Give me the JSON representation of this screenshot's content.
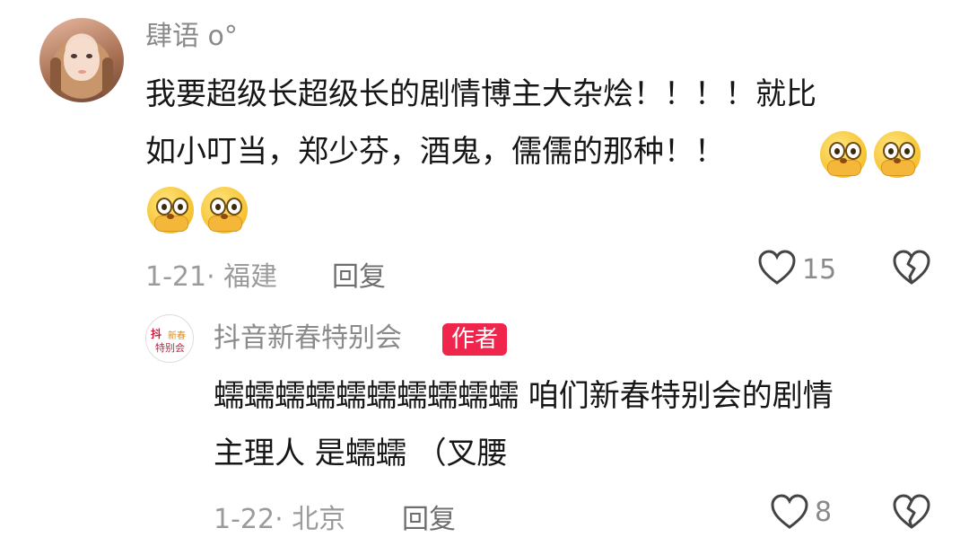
{
  "comment1": {
    "username": "肆语 o°",
    "text_line1": "我要超级长超级长的剧情博主大杂烩！！！！就比",
    "text_line2": "如小叮当，郑少芬，酒鬼，儒儒的那种！！",
    "emoji": "thinking-face-emoji",
    "meta": "1-21· 福建",
    "reply_label": "回复",
    "like_count": "15"
  },
  "comment2": {
    "username": "抖音新春特别会",
    "badge": "作者",
    "avatar_text": [
      "抖",
      "新春",
      "特别会"
    ],
    "text_line1": "蠕蠕蠕蠕蠕蠕蠕蠕蠕蠕 咱们新春特别会的剧情",
    "text_line2": "主理人 是蠕蠕 （叉腰",
    "meta": "1-22· 北京",
    "reply_label": "回复",
    "like_count": "8"
  },
  "colors": {
    "badge": "#f0254c",
    "muted": "#8a8a8a",
    "text": "#161616"
  }
}
